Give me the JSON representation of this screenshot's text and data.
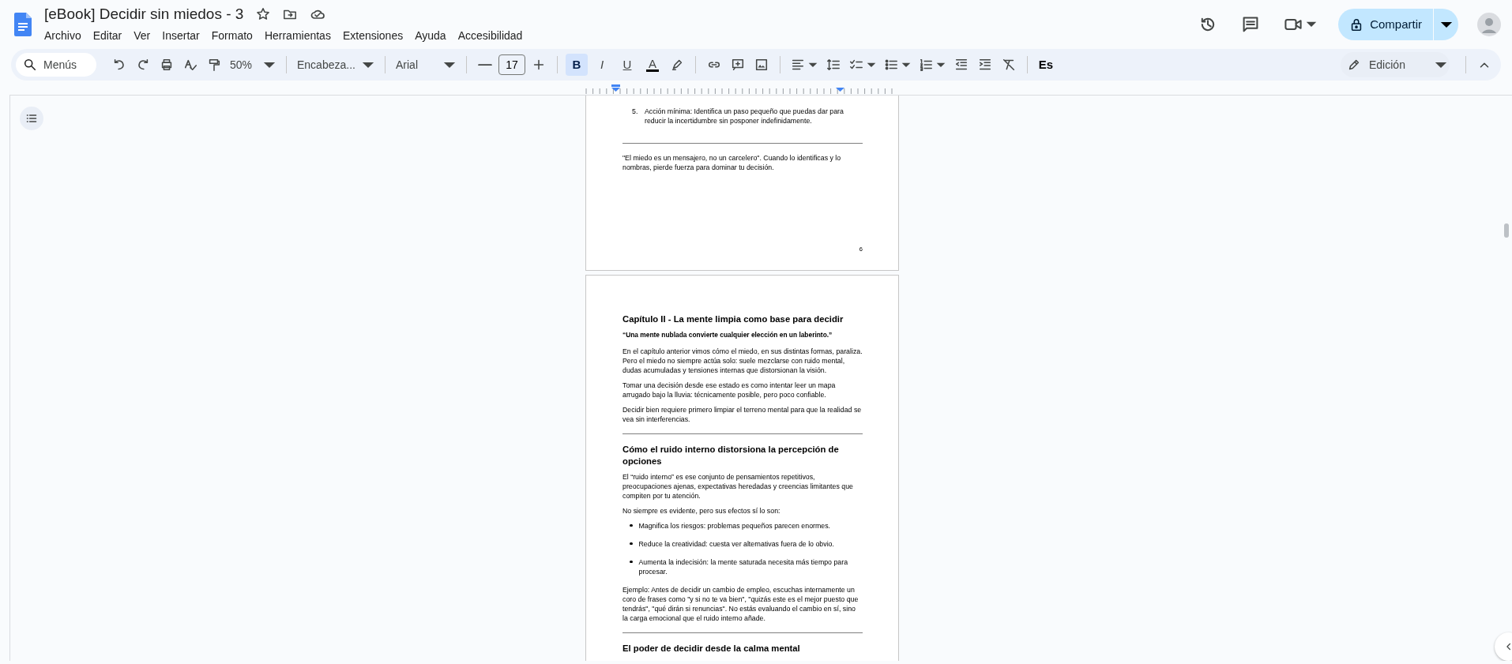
{
  "window": {
    "title": "[eBook] Decidir sin miedos - 3"
  },
  "menus": [
    "Archivo",
    "Editar",
    "Ver",
    "Insertar",
    "Formato",
    "Herramientas",
    "Extensiones",
    "Ayuda",
    "Accesibilidad"
  ],
  "share_button": {
    "label": "Compartir"
  },
  "toolbar": {
    "search": {
      "placeholder": "Menús"
    },
    "zoom": "50%",
    "style": "Encabeza...",
    "font": "Arial",
    "font_size": "17",
    "format_buttons": [
      {
        "label": "B",
        "kind": "bold",
        "selected": true
      },
      {
        "label": "I",
        "kind": "italic",
        "selected": false
      },
      {
        "label": "U",
        "kind": "underline",
        "selected": false
      },
      {
        "label": "A",
        "kind": "color",
        "selected": false
      }
    ],
    "input_tools": "Es",
    "mode": "Edición"
  },
  "pages": [
    {
      "page_number": "6",
      "blocks": [
        {
          "kind": "numbered",
          "marker": "5.",
          "text": "Acción mínima: Identifica un paso pequeño que puedas dar para reducir la incertidumbre sin posponer indefinidamente."
        },
        {
          "kind": "rule"
        },
        {
          "kind": "paragraph",
          "text": "\"El miedo es un mensajero, no un carcelero\". Cuando lo identificas y lo nombras, pierde fuerza para dominar tu decisión."
        }
      ]
    },
    {
      "blocks": [
        {
          "kind": "heading",
          "text": "Capítulo II - La mente limpia como base para decidir"
        },
        {
          "kind": "quote",
          "text": "“Una mente nublada convierte cualquier elección en un laberinto.”"
        },
        {
          "kind": "paragraph",
          "text": "En el capítulo anterior vimos cómo el miedo, en sus distintas formas, paraliza. Pero el miedo no siempre actúa solo: suele mezclarse con ruido mental, dudas acumuladas y tensiones internas que distorsionan la visión."
        },
        {
          "kind": "paragraph",
          "text": "Tomar una decisión desde ese estado es como intentar leer un mapa arrugado bajo la lluvia: técnicamente posible, pero poco confiable."
        },
        {
          "kind": "paragraph",
          "text": "Decidir bien requiere primero limpiar el terreno mental para que la realidad se vea sin interferencias."
        },
        {
          "kind": "rule"
        },
        {
          "kind": "heading",
          "text": "Cómo el ruido interno distorsiona la percepción de opciones"
        },
        {
          "kind": "paragraph",
          "text": "El “ruido interno” es ese conjunto de pensamientos repetitivos, preocupaciones ajenas, expectativas heredadas y creencias limitantes que compiten por tu atención."
        },
        {
          "kind": "paragraph",
          "text": "No siempre es evidente, pero sus efectos sí lo son:"
        },
        {
          "kind": "bullet",
          "text": "Magnifica los riesgos: problemas pequeños parecen enormes."
        },
        {
          "kind": "bullet",
          "text": "Reduce la creatividad: cuesta ver alternativas fuera de lo obvio."
        },
        {
          "kind": "bullet",
          "text": "Aumenta la indecisión: la mente saturada necesita más tiempo para procesar."
        },
        {
          "kind": "paragraph",
          "text": "Ejemplo: Antes de decidir un cambio de empleo, escuchas internamente un coro de frases como \"y si no te va bien\", \"quizás este es el mejor puesto que tendrás\", \"qué dirán si renuncias\". No estás evaluando el cambio en sí, sino la carga emocional que el ruido interno añade."
        },
        {
          "kind": "rule"
        },
        {
          "kind": "heading",
          "text": "El poder de decidir desde la calma mental"
        }
      ]
    }
  ]
}
